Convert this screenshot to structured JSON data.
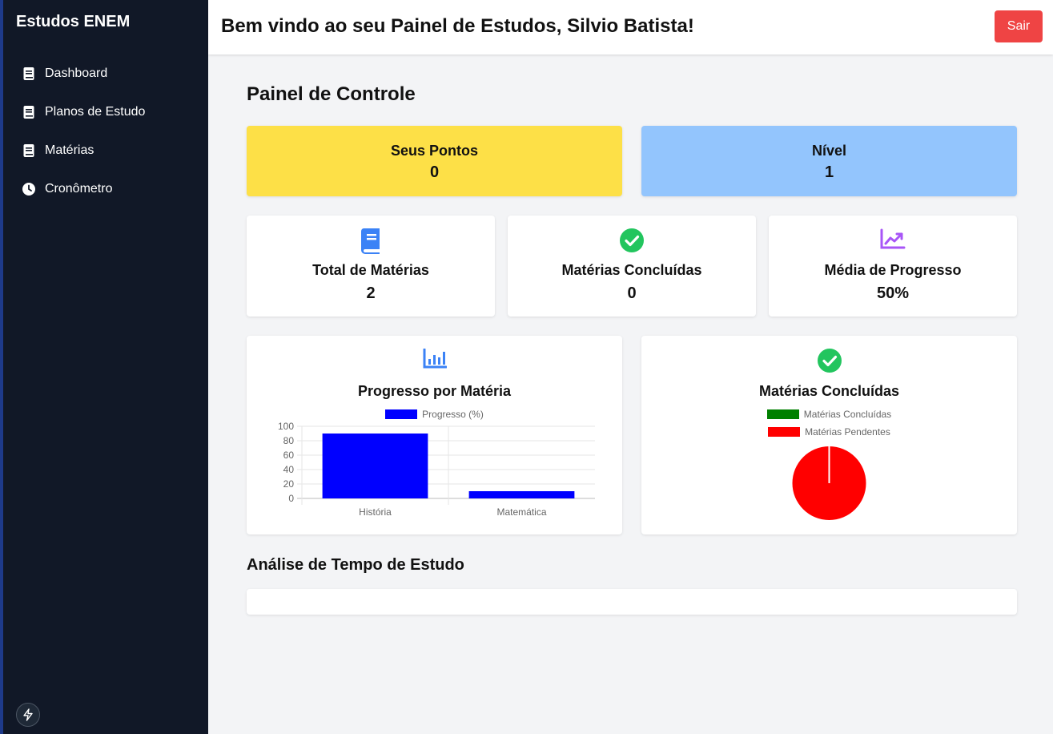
{
  "sidebar": {
    "brand": "Estudos ENEM",
    "items": [
      {
        "label": "Dashboard",
        "icon": "book-icon"
      },
      {
        "label": "Planos de Estudo",
        "icon": "book-icon"
      },
      {
        "label": "Matérias",
        "icon": "book-icon"
      },
      {
        "label": "Cronômetro",
        "icon": "clock-icon"
      }
    ]
  },
  "header": {
    "welcome": "Bem vindo ao seu Painel de Estudos, Silvio Batista!",
    "logout_label": "Sair"
  },
  "main": {
    "title": "Painel de Controle",
    "points": {
      "label": "Seus Pontos",
      "value": "0"
    },
    "level": {
      "label": "Nível",
      "value": "1"
    },
    "stats": [
      {
        "label": "Total de Matérias",
        "value": "2",
        "icon": "book-icon",
        "color": "#3b82f6"
      },
      {
        "label": "Matérias Concluídas",
        "value": "0",
        "icon": "check-circle-icon",
        "color": "#22c55e"
      },
      {
        "label": "Média de Progresso",
        "value": "50%",
        "icon": "chart-line-icon",
        "color": "#a855f7"
      }
    ],
    "progress_chart_title": "Progresso por Matéria",
    "completed_chart_title": "Matérias Concluídas",
    "time_analysis_title": "Análise de Tempo de Estudo"
  },
  "colors": {
    "sidebar_bg": "#111827",
    "points_bg": "#fde047",
    "level_bg": "#93c5fd",
    "logout_bg": "#ef4444"
  },
  "chart_data": [
    {
      "type": "bar",
      "title": "Progresso por Matéria",
      "categories": [
        "História",
        "Matemática"
      ],
      "series": [
        {
          "name": "Progresso (%)",
          "values": [
            90,
            10
          ],
          "color": "#0000ff"
        }
      ],
      "ylim": [
        0,
        100
      ],
      "yticks": [
        0,
        20,
        40,
        60,
        80,
        100
      ],
      "grid": true,
      "legend": "top"
    },
    {
      "type": "pie",
      "title": "Matérias Concluídas",
      "labels": [
        "Matérias Concluídas",
        "Matérias Pendentes"
      ],
      "values": [
        0,
        2
      ],
      "colors": [
        "#008000",
        "#ff0000"
      ],
      "legend": "top"
    }
  ]
}
